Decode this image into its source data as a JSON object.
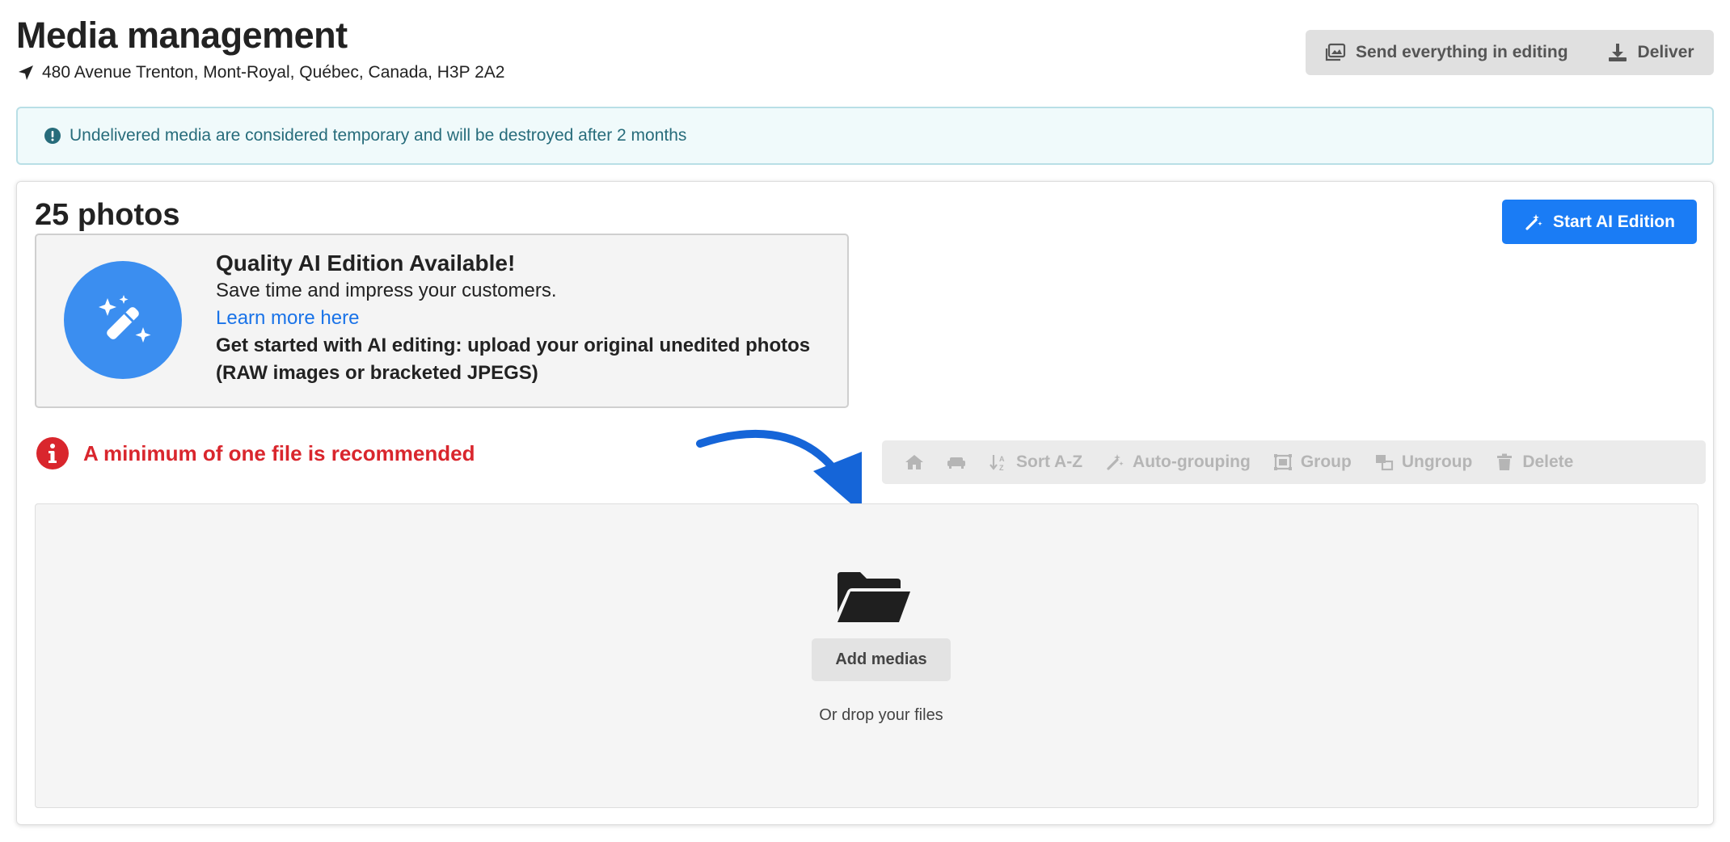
{
  "header": {
    "title": "Media management",
    "address": "480 Avenue Trenton, Mont-Royal, Québec, Canada, H3P 2A2",
    "location_icon": "location-arrow-icon",
    "actions": [
      {
        "label": "Send everything in editing",
        "icon": "images-icon"
      },
      {
        "label": "Deliver",
        "icon": "download-icon"
      }
    ]
  },
  "banner": {
    "text": "Undelivered media are considered temporary and will be destroyed after 2 months",
    "icon": "exclamation-circle-icon"
  },
  "card": {
    "photo_count": "25 photos",
    "start_ai_label": "Start AI Edition",
    "ai_promo": {
      "title": "Quality AI Edition Available!",
      "subtitle": "Save time and impress your customers.",
      "link": "Learn more here",
      "instructions_line1": "Get started with AI editing: upload your original unedited photos",
      "instructions_line2": "(RAW images or bracketed JPEGS)",
      "icon": "magic-wand-icon"
    },
    "warning": "A minimum of one file is recommended",
    "toolbar": {
      "sort": "Sort A-Z",
      "auto_group": "Auto-grouping",
      "group": "Group",
      "ungroup": "Ungroup",
      "delete": "Delete"
    },
    "dropzone": {
      "button": "Add medias",
      "hint": "Or drop your files",
      "icon": "folder-open-icon"
    }
  },
  "colors": {
    "primary": "#1a7cf5",
    "error": "#d9262d",
    "info_text": "#276c7b",
    "info_bg": "#f0fafb",
    "arrow": "#1565d8"
  }
}
